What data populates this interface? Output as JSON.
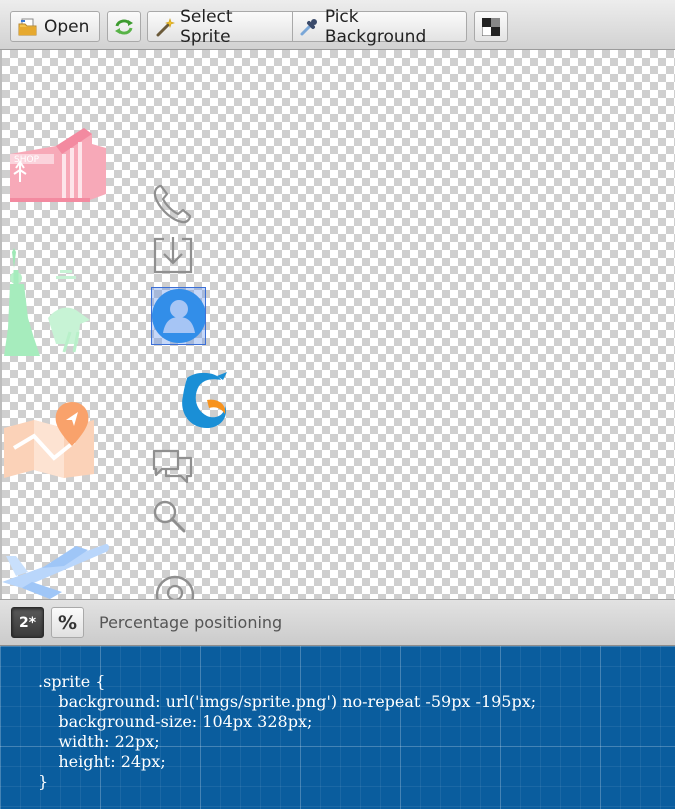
{
  "toolbar": {
    "open_label": "Open",
    "select_sprite_label": "Select Sprite",
    "pick_background_label": "Pick Background",
    "icons": [
      "folder-icon",
      "refresh-icon",
      "magic-wand-icon",
      "eyedropper-icon",
      "checkerboard-icon"
    ]
  },
  "canvas": {
    "background": "transparency-checkerboard",
    "sprites": [
      "shop-sign",
      "phone-icon",
      "download-icon",
      "user-avatar-icon",
      "dolphin-logo",
      "statue-of-liberty",
      "map-pin",
      "chat-bubbles-icon",
      "search-icon",
      "airplane",
      "location-pin-icon"
    ],
    "selected_sprite": "user-avatar-icon",
    "selection_color": "#3b6fd6"
  },
  "bottom_bar": {
    "retina_label": "2*",
    "percent_label": "%",
    "positioning_label": "Percentage positioning"
  },
  "code": {
    "lines": [
      ".sprite {",
      "    background: url('imgs/sprite.png') no-repeat -59px -195px;",
      "    background-size: 104px 328px;",
      "    width: 22px;",
      "    height: 24px;",
      "}"
    ]
  },
  "colors": {
    "code_panel_bg": "#0a5d9e",
    "avatar_blue": "#1e8fe8",
    "dolphin_blue": "#1a8fd6",
    "dolphin_orange": "#f7931e"
  }
}
